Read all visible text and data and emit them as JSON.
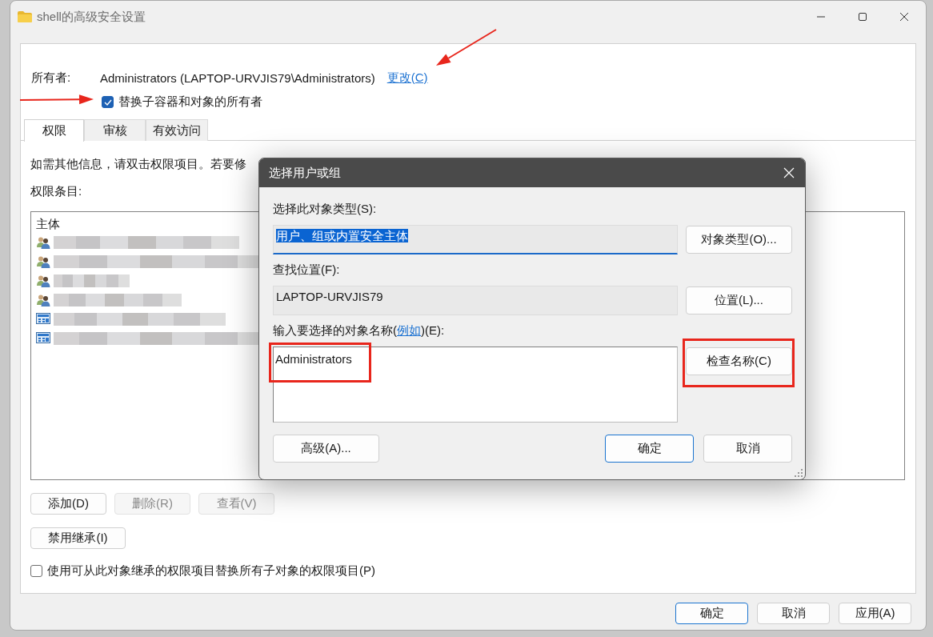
{
  "window": {
    "title": "shell的高级安全设置"
  },
  "owner": {
    "label": "所有者:",
    "value": "Administrators (LAPTOP-URVJIS79\\Administrators)",
    "change_link": "更改(C)"
  },
  "replace_owner": {
    "label": "替换子容器和对象的所有者",
    "checked": true
  },
  "tabs": [
    {
      "label": "权限",
      "selected": true
    },
    {
      "label": "审核",
      "selected": false
    },
    {
      "label": "有效访问",
      "selected": false
    }
  ],
  "info_text": "如需其他信息，请双击权限项目。若要修",
  "entries_label": "权限条目:",
  "table": {
    "columns": [
      "主体"
    ],
    "rows": [
      {
        "kind": "group"
      },
      {
        "kind": "group"
      },
      {
        "kind": "group"
      },
      {
        "kind": "group"
      },
      {
        "kind": "computer"
      },
      {
        "kind": "computer"
      }
    ]
  },
  "entry_buttons": [
    {
      "label": "添加(D)",
      "disabled": false
    },
    {
      "label": "删除(R)",
      "disabled": true
    },
    {
      "label": "查看(V)",
      "disabled": true
    }
  ],
  "inherit_button": "禁用继承(I)",
  "replace_child": {
    "label": "使用可从此对象继承的权限项目替换所有子对象的权限项目(P)",
    "checked": false
  },
  "footer_buttons": [
    {
      "label": "确定",
      "default": true
    },
    {
      "label": "取消",
      "default": false
    },
    {
      "label": "应用(A)",
      "default": false
    }
  ],
  "dialog": {
    "title": "选择用户或组",
    "object_type_label": "选择此对象类型(S):",
    "object_type_value": "用户、组或内置安全主体",
    "object_type_button": "对象类型(O)...",
    "location_label": "查找位置(F):",
    "location_value": "LAPTOP-URVJIS79",
    "location_button": "位置(L)...",
    "names_label_before": "输入要选择的对象名称(",
    "names_link": "例如",
    "names_label_after": ")(E):",
    "names_value": "Administrators",
    "check_button": "检查名称(C)",
    "advanced_button": "高级(A)...",
    "ok_button": "确定",
    "cancel_button": "取消"
  },
  "annotations": [
    {
      "kind": "arrow"
    },
    {
      "kind": "arrow"
    },
    {
      "kind": "box"
    },
    {
      "kind": "box"
    }
  ]
}
